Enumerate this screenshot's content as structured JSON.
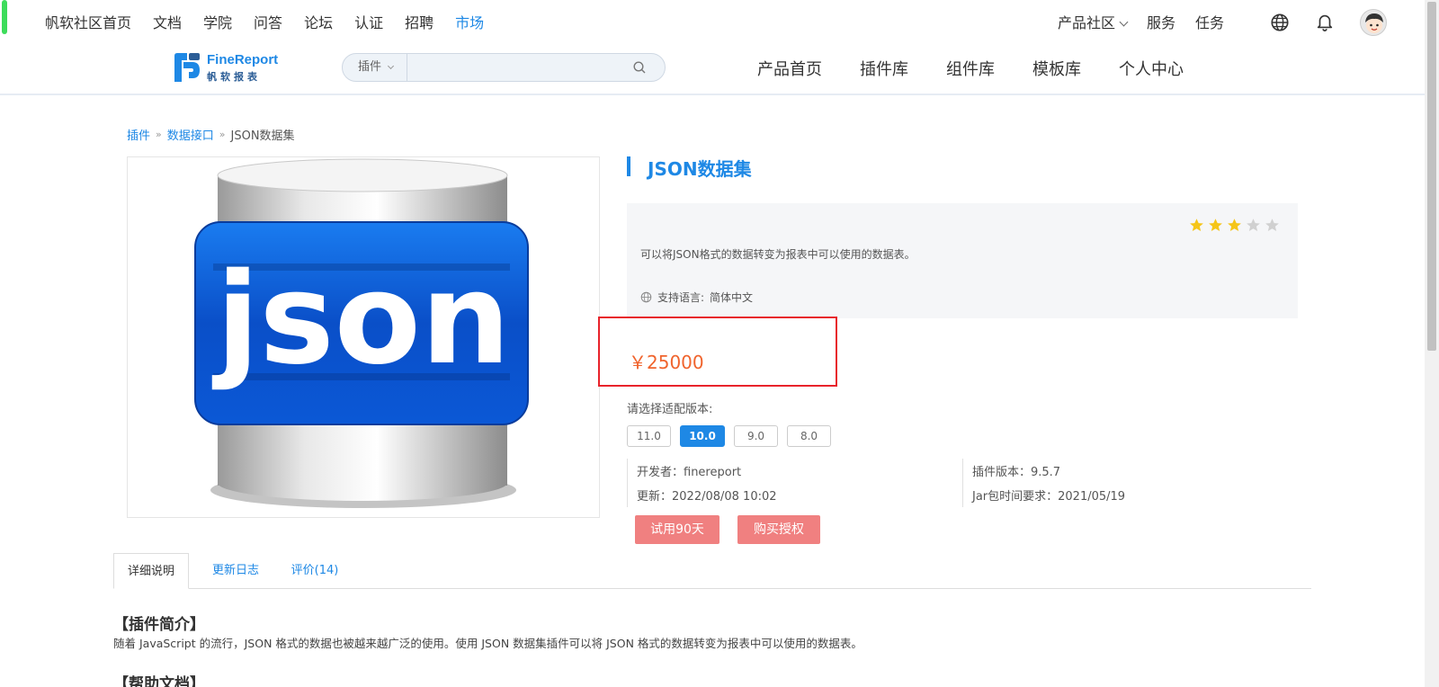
{
  "topnav": {
    "items": [
      "帆软社区首页",
      "文档",
      "学院",
      "问答",
      "论坛",
      "认证",
      "招聘",
      "市场"
    ],
    "active_index": 7,
    "right": [
      "产品社区",
      "服务",
      "任务"
    ]
  },
  "logo": {
    "name": "FineReport",
    "sub": "帆软报表"
  },
  "search": {
    "type": "插件",
    "placeholder": ""
  },
  "mainnav": [
    "产品首页",
    "插件库",
    "组件库",
    "模板库",
    "个人中心"
  ],
  "breadcrumb": {
    "items": [
      "插件",
      "数据接口"
    ],
    "current": "JSON数据集",
    "sep": "»"
  },
  "plugin": {
    "title": "JSON数据集",
    "image_text": "json",
    "rating": 3,
    "rating_max": 5,
    "description": "可以将JSON格式的数据转变为报表中可以使用的数据表。",
    "language_label": "支持语言:",
    "language": "简体中文",
    "price": "￥25000",
    "version_label": "请选择适配版本:",
    "versions": [
      "11.0",
      "10.0",
      "9.0",
      "8.0"
    ],
    "active_version": 1,
    "developer": "开发者：finereport",
    "updated": "更新：2022/08/08 10:02",
    "plugin_version": "插件版本：9.5.7",
    "jar_requirement": "Jar包时间要求：2021/05/19",
    "trial_button": "试用90天",
    "buy_button": "购买授权"
  },
  "tabs": [
    "详细说明",
    "更新日志",
    "评价(14)"
  ],
  "content": {
    "section1_title": "【插件简介】",
    "section1_text": "随着 JavaScript 的流行，JSON 格式的数据也被越来越广泛的使用。使用 JSON 数据集插件可以将 JSON 格式的数据转变为报表中可以使用的数据表。",
    "section2_title": "【帮助文档】"
  },
  "colors": {
    "accent": "#1e88e5",
    "price": "#f0642d",
    "button": "#f08080",
    "highlight_border": "#e8232b",
    "star": "#f5c518"
  }
}
